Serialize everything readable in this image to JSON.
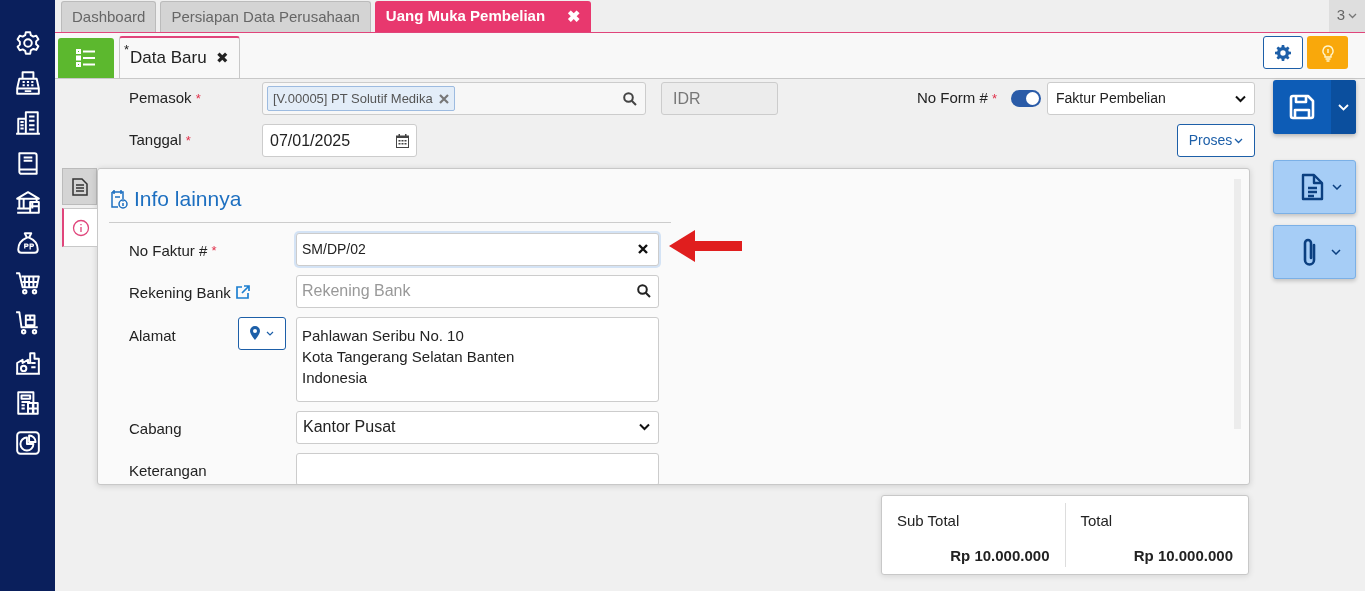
{
  "sidebar": {
    "items": [
      {
        "kind": "settings"
      },
      {
        "kind": "register"
      },
      {
        "kind": "building"
      },
      {
        "kind": "book"
      },
      {
        "kind": "bank"
      },
      {
        "kind": "moneybag"
      },
      {
        "kind": "cart"
      },
      {
        "kind": "cartbox"
      },
      {
        "kind": "factory"
      },
      {
        "kind": "tax"
      },
      {
        "kind": "chart"
      }
    ]
  },
  "tabs": [
    {
      "label": "Dashboard",
      "selected": false
    },
    {
      "label": "Persiapan Data Perusahaan",
      "selected": false
    },
    {
      "label": "Uang Muka Pembelian",
      "selected": true,
      "close": "✖"
    }
  ],
  "tab_count": "3",
  "doc_tab": {
    "modified_mark": "*",
    "label": "Data Baru",
    "close": "✖"
  },
  "header": {
    "supplier": {
      "label": "Pemasok",
      "mark": "*",
      "tag": "[V.00005] PT Solutif Medika",
      "currency": "IDR"
    },
    "form_no": {
      "label": "No Form #",
      "mark": "*",
      "on": true,
      "value": "Faktur Pembelian"
    },
    "date": {
      "label": "Tanggal",
      "mark": "*",
      "value": "07/01/2025"
    },
    "process_button": "Proses"
  },
  "side_tabs": [
    {
      "kind": "document",
      "selected": false
    },
    {
      "kind": "info",
      "selected": true
    }
  ],
  "panel": {
    "title": "Info lainnya",
    "fields": [
      {
        "kind": "clearable",
        "label": "No Faktur #",
        "mark": "*",
        "value": "SM/DP/02"
      },
      {
        "kind": "search",
        "label": "Rekening Bank",
        "placeholder": "Rekening Bank"
      },
      {
        "kind": "address",
        "label": "Alamat",
        "value": "Pahlawan Seribu No. 10\nKota Tangerang Selatan Banten\nIndonesia"
      },
      {
        "kind": "select",
        "label": "Cabang",
        "value": "Kantor Pusat"
      },
      {
        "kind": "text",
        "label": "Keterangan"
      }
    ]
  },
  "totals": [
    {
      "label": "Sub Total",
      "value": "Rp 10.000.000"
    },
    {
      "label": "Total",
      "value": "Rp 10.000.000"
    }
  ]
}
